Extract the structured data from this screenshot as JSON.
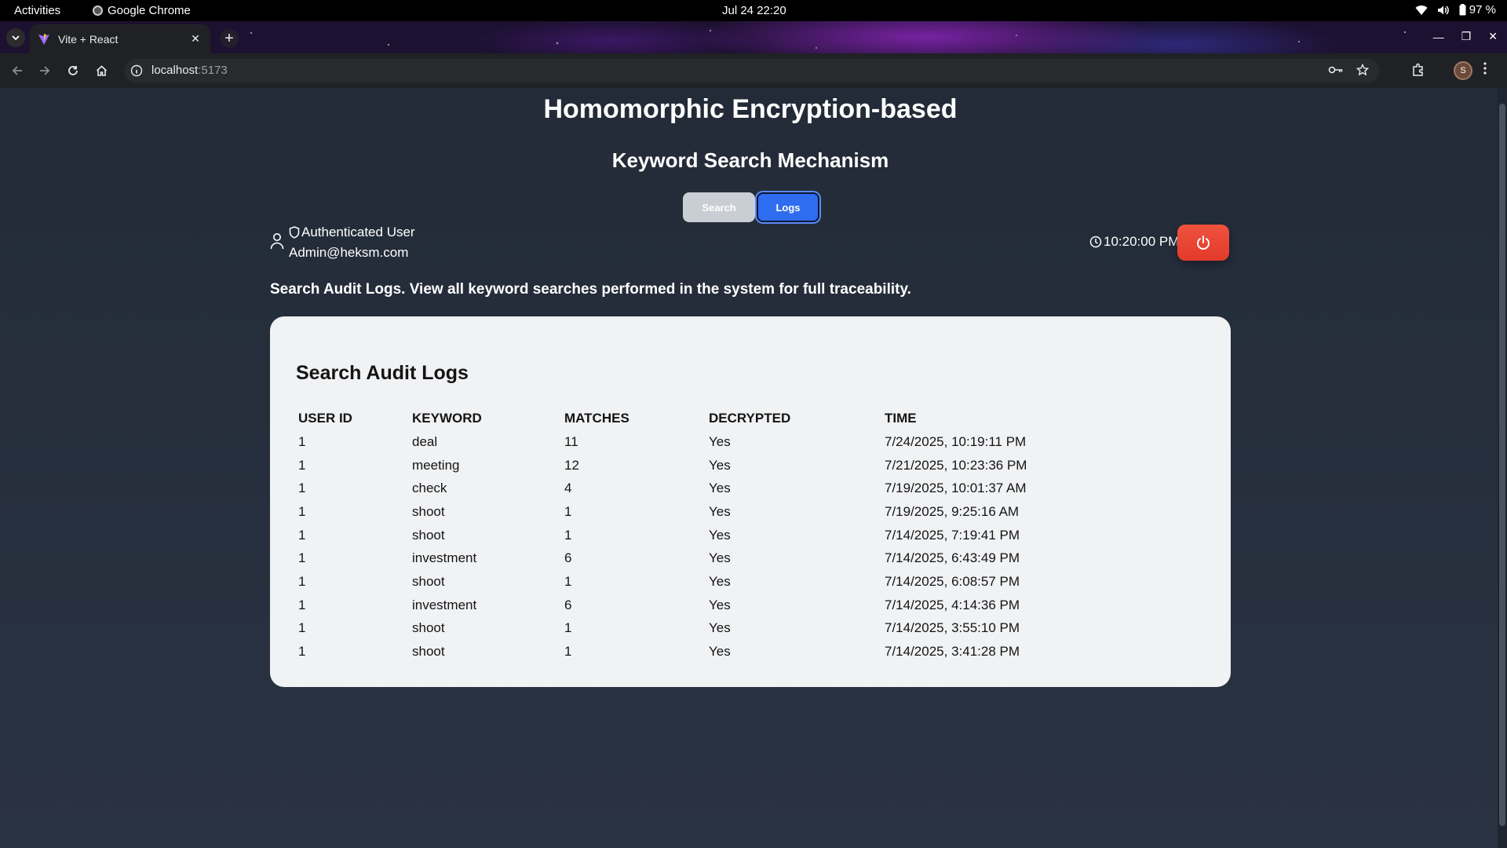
{
  "system_bar": {
    "activities": "Activities",
    "app_name": "Google Chrome",
    "datetime": "Jul 24  22:20",
    "battery": "97 %"
  },
  "browser": {
    "tab_title": "Vite + React",
    "url_host": "localhost",
    "url_port": ":5173",
    "profile_initial": "S"
  },
  "page": {
    "title": "Homomorphic Encryption-based",
    "subtitle": "Keyword Search Mechanism",
    "tabs": {
      "search": "Search",
      "logs": "Logs"
    },
    "user": {
      "role": "Authenticated User",
      "email": "Admin@heksm.com"
    },
    "clock": "10:20:00 PM",
    "description": "Search Audit Logs. View all keyword searches performed in the system for full traceability.",
    "card": {
      "title": "Search Audit Logs",
      "columns": [
        "USER ID",
        "KEYWORD",
        "MATCHES",
        "DECRYPTED",
        "TIME"
      ],
      "rows": [
        [
          "1",
          "deal",
          "11",
          "Yes",
          "7/24/2025, 10:19:11 PM"
        ],
        [
          "1",
          "meeting",
          "12",
          "Yes",
          "7/21/2025, 10:23:36 PM"
        ],
        [
          "1",
          "check",
          "4",
          "Yes",
          "7/19/2025, 10:01:37 AM"
        ],
        [
          "1",
          "shoot",
          "1",
          "Yes",
          "7/19/2025, 9:25:16 AM"
        ],
        [
          "1",
          "shoot",
          "1",
          "Yes",
          "7/14/2025, 7:19:41 PM"
        ],
        [
          "1",
          "investment",
          "6",
          "Yes",
          "7/14/2025, 6:43:49 PM"
        ],
        [
          "1",
          "shoot",
          "1",
          "Yes",
          "7/14/2025, 6:08:57 PM"
        ],
        [
          "1",
          "investment",
          "6",
          "Yes",
          "7/14/2025, 4:14:36 PM"
        ],
        [
          "1",
          "shoot",
          "1",
          "Yes",
          "7/14/2025, 3:55:10 PM"
        ],
        [
          "1",
          "shoot",
          "1",
          "Yes",
          "7/14/2025, 3:41:28 PM"
        ]
      ]
    }
  },
  "colors": {
    "page_bg": "#2b3544",
    "logs_active": "#2f6df0",
    "search_inactive": "#c9cdd4",
    "power_button": "#e8442f",
    "card_bg": "#f1f2f4"
  }
}
